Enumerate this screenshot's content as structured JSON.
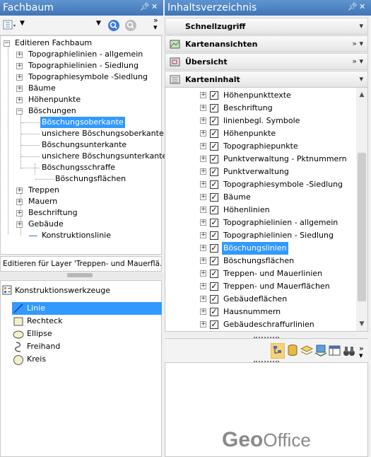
{
  "left_panel": {
    "title": "Fachbaum",
    "pin_icon": "pin-icon",
    "close_icon": "close-icon",
    "tree": {
      "root": "Editieren Fachbaum",
      "items": [
        "Topographielinien - allgemein",
        "Topographielinien - Siedlung",
        "Topographiesymbole -Siedlung",
        "Bäume",
        "Höhenpunkte",
        "Böschungen"
      ],
      "boeschungen_children": [
        "Böschungsoberkante",
        "unsichere Böschungsoberkante",
        "Böschungsunterkante",
        "unsichere Böschungsunterkante",
        "Böschungsschraffe"
      ],
      "schraffe_child": "Böschungsflächen",
      "items_after": [
        "Treppen",
        "Mauern",
        "Beschriftung",
        "Gebäude"
      ],
      "gebaeude_child": "Konstruktionslinie"
    },
    "layer_bar": "Editieren für Layer 'Treppen- und Mauerflä...",
    "tools": {
      "header": "Konstruktionswerkzeuge",
      "items": [
        "Linie",
        "Rechteck",
        "Ellipse",
        "Freihand",
        "Kreis"
      ]
    }
  },
  "right_panel": {
    "title": "Inhaltsverzeichnis",
    "sections": [
      "Schnellzugriff",
      "Kartenansichten",
      "Übersicht",
      "Karteninhalt"
    ],
    "layers": [
      "Höhenpunkttexte",
      "Beschriftung",
      "linienbegl. Symbole",
      "Höhenpunkte",
      "Topographiepunkte",
      "Punktverwaltung - Pktnummern",
      "Punktverwaltung",
      "Topographiesymbole -Siedlung",
      "Bäume",
      "Höhenlinien",
      "Topographielinien - allgemein",
      "Topographielinien - Siedlung",
      "Böschungslinien",
      "Böschungsflächen",
      "Treppen- und Mauerlinien",
      "Treppen- und Mauerflächen",
      "Gebäudeflächen",
      "Hausnummern",
      "Gebäudeschraffurlinien"
    ],
    "logo": {
      "part1": "Geo",
      "part2": "Office"
    }
  },
  "colors": {
    "title_bar": "#4a80c2",
    "selection": "#3399ff"
  }
}
